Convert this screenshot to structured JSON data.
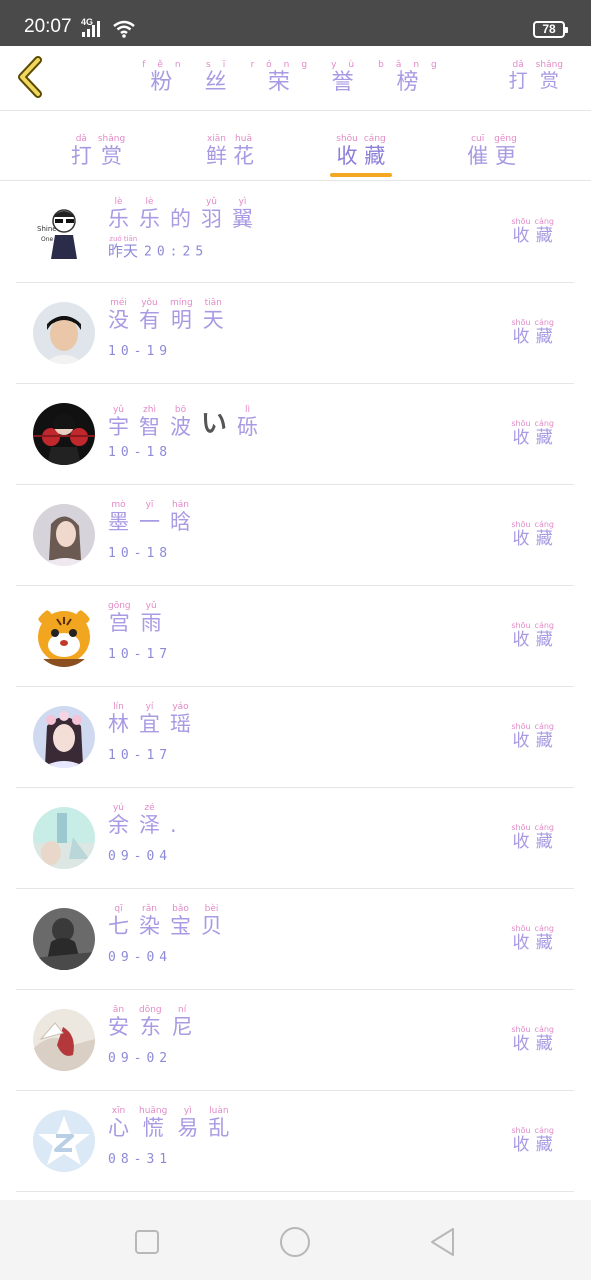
{
  "status_bar": {
    "time": "20:07",
    "network": "4G",
    "battery": "78"
  },
  "header": {
    "title": [
      [
        "fěn",
        "粉"
      ],
      [
        "sī",
        "丝"
      ],
      [
        "róng",
        "荣"
      ],
      [
        "yù",
        "誉"
      ],
      [
        "bǎng",
        "榜"
      ]
    ],
    "action": [
      [
        "dǎ",
        "打"
      ],
      [
        "shǎng",
        "赏"
      ]
    ]
  },
  "tabs": [
    {
      "chars": [
        [
          "dǎ",
          "打"
        ],
        [
          "shǎng",
          "赏"
        ]
      ]
    },
    {
      "chars": [
        [
          "xiān",
          "鲜"
        ],
        [
          "huā",
          "花"
        ]
      ]
    },
    {
      "chars": [
        [
          "shōu",
          "收"
        ],
        [
          "cáng",
          "藏"
        ]
      ],
      "active": true
    },
    {
      "chars": [
        [
          "cuī",
          "催"
        ],
        [
          "gēng",
          "更"
        ]
      ]
    }
  ],
  "list_action": [
    [
      "shōu",
      "收"
    ],
    [
      "cáng",
      "藏"
    ]
  ],
  "rows": [
    {
      "name": [
        [
          "lè",
          "乐"
        ],
        [
          "lè",
          "乐"
        ],
        [
          "",
          "的"
        ],
        [
          "yǔ",
          "羽"
        ],
        [
          "yì",
          "翼"
        ]
      ],
      "date_chars": [
        [
          "zuó",
          "昨"
        ],
        [
          "tiān",
          "天"
        ]
      ],
      "date": "20:25",
      "avatar": "cartoon-boy"
    },
    {
      "name": [
        [
          "méi",
          "没"
        ],
        [
          "yǒu",
          "有"
        ],
        [
          "míng",
          "明"
        ],
        [
          "tiān",
          "天"
        ]
      ],
      "date": "10-19",
      "avatar": "boy-photo"
    },
    {
      "name": [
        [
          "yǔ",
          "宇"
        ],
        [
          "zhì",
          "智"
        ],
        [
          "bō",
          "波"
        ],
        [
          "",
          "い"
        ],
        [
          "lì",
          "砾"
        ]
      ],
      "date": "10-18",
      "avatar": "anime-red"
    },
    {
      "name": [
        [
          "mò",
          "墨"
        ],
        [
          "yī",
          "一"
        ],
        [
          "hán",
          "晗"
        ]
      ],
      "date": "10-18",
      "avatar": "girl-photo"
    },
    {
      "name": [
        [
          "gōng",
          "宫"
        ],
        [
          "yǔ",
          "雨"
        ]
      ],
      "date": "10-17",
      "avatar": "tiger"
    },
    {
      "name": [
        [
          "lín",
          "林"
        ],
        [
          "yí",
          "宜"
        ],
        [
          "yáo",
          "瑶"
        ]
      ],
      "date": "10-17",
      "avatar": "girl-flowers"
    },
    {
      "name": [
        [
          "yú",
          "余"
        ],
        [
          "zé",
          "泽"
        ],
        [
          "",
          "."
        ]
      ],
      "date": "09-04",
      "avatar": "blue-scene"
    },
    {
      "name": [
        [
          "qī",
          "七"
        ],
        [
          "rǎn",
          "染"
        ],
        [
          "bǎo",
          "宝"
        ],
        [
          "bèi",
          "贝"
        ]
      ],
      "date": "09-04",
      "avatar": "dark-photo"
    },
    {
      "name": [
        [
          "ān",
          "安"
        ],
        [
          "dōng",
          "东"
        ],
        [
          "ní",
          "尼"
        ]
      ],
      "date": "09-02",
      "avatar": "paper-red"
    },
    {
      "name": [
        [
          "xīn",
          "心"
        ],
        [
          "huāng",
          "慌"
        ],
        [
          "yì",
          "易"
        ],
        [
          "luàn",
          "乱"
        ]
      ],
      "date": "08-31",
      "avatar": "default-star"
    }
  ],
  "colors": {
    "accent": "#f5a623",
    "text": "#a99be3",
    "pinyin": "#e38ac8"
  }
}
